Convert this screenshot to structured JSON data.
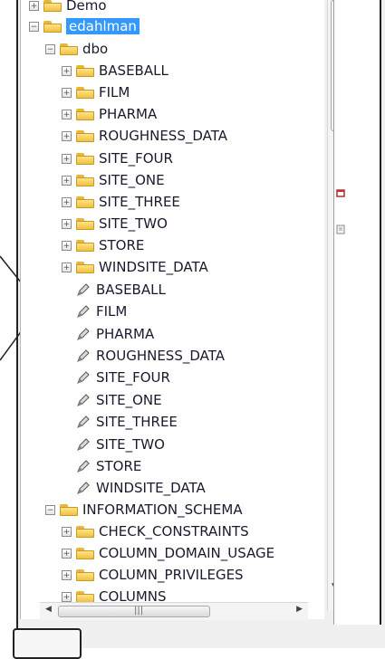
{
  "tree": {
    "nodes": [
      {
        "label": "Demo",
        "kind": "folder",
        "expander": "+"
      },
      {
        "label": "edahlman",
        "kind": "folder",
        "expander": "−",
        "selected": true
      },
      {
        "label": "dbo",
        "kind": "folder",
        "expander": "−"
      },
      {
        "label": "BASEBALL",
        "kind": "folder",
        "expander": "+"
      },
      {
        "label": "FILM",
        "kind": "folder",
        "expander": "+"
      },
      {
        "label": "PHARMA",
        "kind": "folder",
        "expander": "+"
      },
      {
        "label": "ROUGHNESS_DATA",
        "kind": "folder",
        "expander": "+"
      },
      {
        "label": "SITE_FOUR",
        "kind": "folder",
        "expander": "+"
      },
      {
        "label": "SITE_ONE",
        "kind": "folder",
        "expander": "+"
      },
      {
        "label": "SITE_THREE",
        "kind": "folder",
        "expander": "+"
      },
      {
        "label": "SITE_TWO",
        "kind": "folder",
        "expander": "+"
      },
      {
        "label": "STORE",
        "kind": "folder",
        "expander": "+"
      },
      {
        "label": "WINDSITE_DATA",
        "kind": "folder",
        "expander": "+"
      },
      {
        "label": "BASEBALL",
        "kind": "pen"
      },
      {
        "label": "FILM",
        "kind": "pen"
      },
      {
        "label": "PHARMA",
        "kind": "pen"
      },
      {
        "label": "ROUGHNESS_DATA",
        "kind": "pen"
      },
      {
        "label": "SITE_FOUR",
        "kind": "pen"
      },
      {
        "label": "SITE_ONE",
        "kind": "pen"
      },
      {
        "label": "SITE_THREE",
        "kind": "pen"
      },
      {
        "label": "SITE_TWO",
        "kind": "pen"
      },
      {
        "label": "STORE",
        "kind": "pen"
      },
      {
        "label": "WINDSITE_DATA",
        "kind": "pen"
      },
      {
        "label": "INFORMATION_SCHEMA",
        "kind": "folder",
        "expander": "−"
      },
      {
        "label": "CHECK_CONSTRAINTS",
        "kind": "folder",
        "expander": "+"
      },
      {
        "label": "COLUMN_DOMAIN_USAGE",
        "kind": "folder",
        "expander": "+"
      },
      {
        "label": "COLUMN_PRIVILEGES",
        "kind": "folder",
        "expander": "+"
      },
      {
        "label": "COLUMNS",
        "kind": "folder",
        "expander": "+"
      }
    ]
  },
  "scrollbar": {
    "v_grip": "≡",
    "v_down": "▼",
    "h_left": "◀",
    "h_right": "▶",
    "h_grip": "|||"
  },
  "icons": {
    "folder": "folder-icon",
    "pen": "pencil-icon",
    "expander": "expand-collapse-icon"
  },
  "colors": {
    "selection": "#3399ff",
    "folder": "#f0c040"
  }
}
